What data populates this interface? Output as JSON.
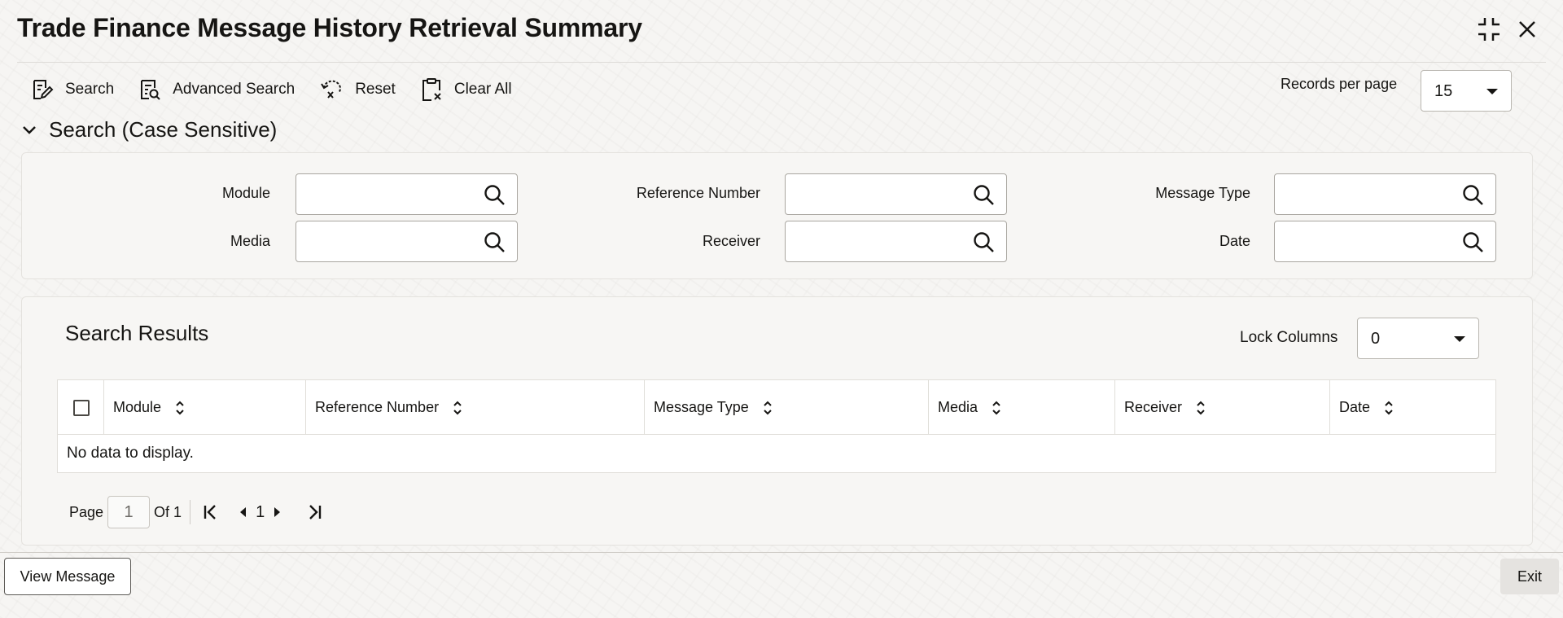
{
  "window": {
    "title": "Trade Finance Message History Retrieval Summary"
  },
  "toolbar": {
    "search_label": "Search",
    "advanced_search_label": "Advanced Search",
    "reset_label": "Reset",
    "clear_all_label": "Clear All",
    "records_per_page_label": "Records per page",
    "records_per_page_value": "15"
  },
  "search_section": {
    "title": "Search (Case Sensitive)",
    "fields": {
      "module": "Module",
      "reference_number": "Reference Number",
      "message_type": "Message Type",
      "media": "Media",
      "receiver": "Receiver",
      "date": "Date"
    }
  },
  "results": {
    "title": "Search Results",
    "lock_columns_label": "Lock Columns",
    "lock_columns_value": "0",
    "columns": [
      "Module",
      "Reference Number",
      "Message Type",
      "Media",
      "Receiver",
      "Date"
    ],
    "empty_text": "No data to display."
  },
  "pager": {
    "page_label": "Page",
    "current_page": "1",
    "of_label": "Of 1",
    "page_number": "1"
  },
  "footer": {
    "view_message_label": "View Message",
    "exit_label": "Exit"
  }
}
